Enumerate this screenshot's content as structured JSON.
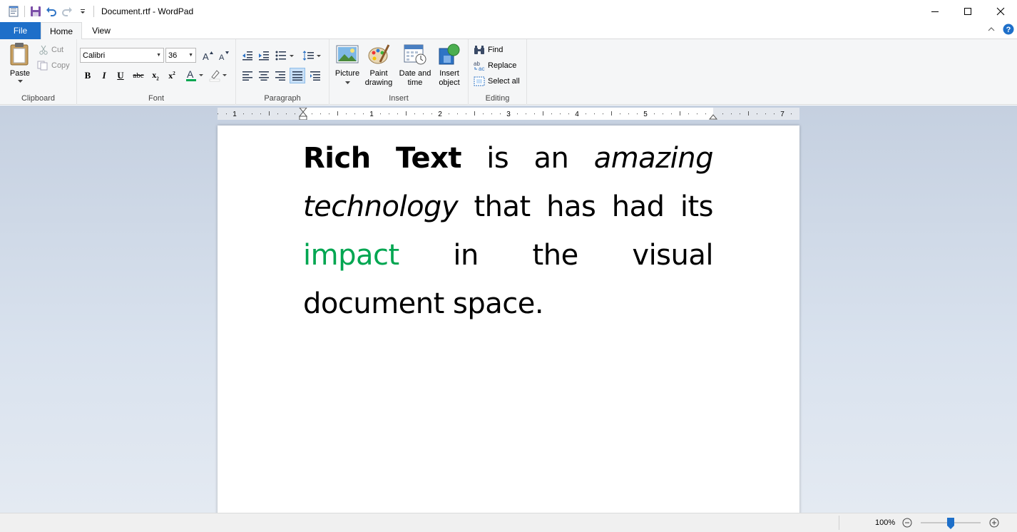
{
  "window": {
    "title": "Document.rtf - WordPad"
  },
  "tabs": {
    "file": "File",
    "home": "Home",
    "view": "View"
  },
  "clipboard": {
    "label": "Clipboard",
    "paste": "Paste",
    "cut": "Cut",
    "copy": "Copy"
  },
  "font": {
    "label": "Font",
    "family": "Calibri",
    "size": "36"
  },
  "paragraph": {
    "label": "Paragraph"
  },
  "insert": {
    "label": "Insert",
    "picture": "Picture",
    "paint_line1": "Paint",
    "paint_line2": "drawing",
    "datetime_line1": "Date and",
    "datetime_line2": "time",
    "object_line1": "Insert",
    "object_line2": "object"
  },
  "editing": {
    "label": "Editing",
    "find": "Find",
    "replace": "Replace",
    "select_all": "Select all"
  },
  "ruler": {
    "marks": [
      "1",
      "1",
      "2",
      "3",
      "4",
      "5",
      "7"
    ]
  },
  "document": {
    "line1": {
      "bold1": "Rich",
      "bold2": "Text",
      "w1": "is",
      "w2": "an",
      "italic": "amazing"
    },
    "line2": {
      "italic": "technology",
      "w1": "that",
      "w2": "has",
      "w3": "had",
      "w4": "its"
    },
    "line3": {
      "green": "impact",
      "w1": "in",
      "w2": "the",
      "w3": "visual"
    },
    "line4": "document space."
  },
  "status": {
    "zoom": "100%",
    "zoom_level_percent": 100
  },
  "colors": {
    "accent": "#1e6fc9",
    "highlight_word": "#00a651"
  }
}
